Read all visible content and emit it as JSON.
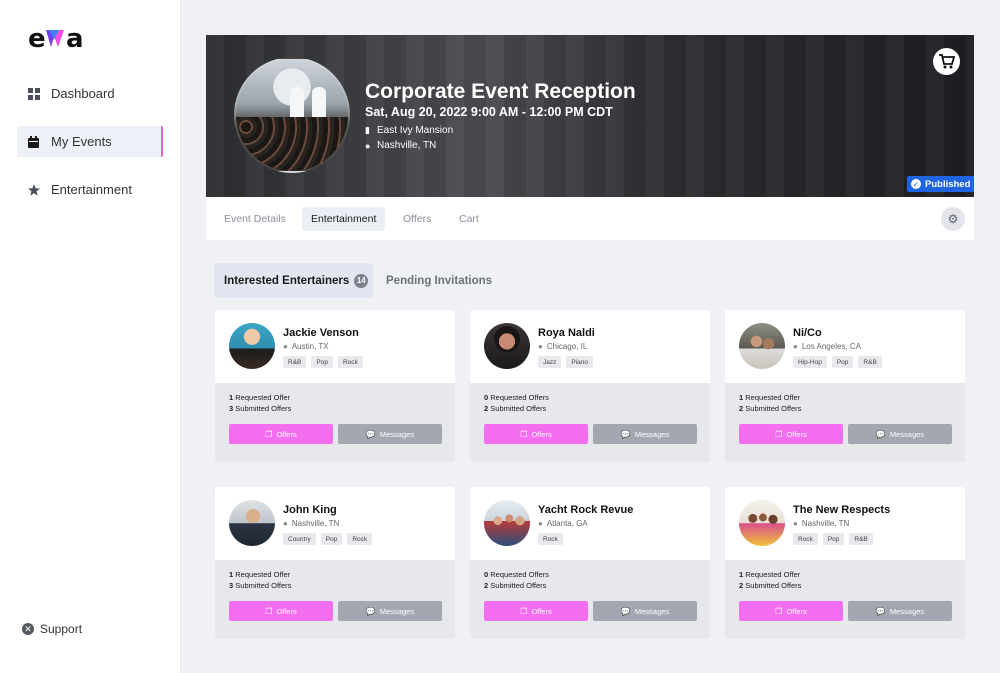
{
  "app": {
    "logo": "eva"
  },
  "sidebar": {
    "items": [
      {
        "label": "Dashboard",
        "icon": "grid-icon"
      },
      {
        "label": "My Events",
        "icon": "calendar-icon"
      },
      {
        "label": "Entertainment",
        "icon": "star-icon"
      }
    ],
    "support": "Support"
  },
  "event": {
    "title": "Corporate Event Reception",
    "datetime": "Sat, Aug 20, 2022 9:00 AM - 12:00 PM CDT",
    "venue": "East Ivy Mansion",
    "city": "Nashville, TN",
    "status": "Published"
  },
  "tabs": [
    "Event Details",
    "Entertainment",
    "Offers",
    "Cart"
  ],
  "subtabs": {
    "interested": "Interested Entertainers",
    "count": "14",
    "pending": "Pending Invitations"
  },
  "labels": {
    "requested": "Requested Offer",
    "requested_plural": "Requested Offers",
    "submitted": "Submitted Offers",
    "offers_btn": "Offers",
    "messages_btn": "Messages"
  },
  "cards": [
    {
      "name": "Jackie Venson",
      "location": "Austin, TX",
      "genres": [
        "R&B",
        "Pop",
        "Rock"
      ],
      "requested": "1",
      "requested_label": "Requested Offer",
      "submitted": "3"
    },
    {
      "name": "Roya Naldi",
      "location": "Chicago, IL",
      "genres": [
        "Jazz",
        "Piano"
      ],
      "requested": "0",
      "requested_label": "Requested Offers",
      "submitted": "2"
    },
    {
      "name": "Ni/Co",
      "location": "Los Angeles, CA",
      "genres": [
        "Hip-Hop",
        "Pop",
        "R&B"
      ],
      "requested": "1",
      "requested_label": "Requested Offer",
      "submitted": "2"
    },
    {
      "name": "John King",
      "location": "Nashville, TN",
      "genres": [
        "Country",
        "Pop",
        "Rock"
      ],
      "requested": "1",
      "requested_label": "Requested Offer",
      "submitted": "3"
    },
    {
      "name": "Yacht Rock Revue",
      "location": "Atlanta, GA",
      "genres": [
        "Rock"
      ],
      "requested": "0",
      "requested_label": "Requested Offers",
      "submitted": "2"
    },
    {
      "name": "The New Respects",
      "location": "Nashville, TN",
      "genres": [
        "Rock",
        "Pop",
        "R&B"
      ],
      "requested": "1",
      "requested_label": "Requested Offer",
      "submitted": "2"
    }
  ],
  "colors": {
    "accent": "#f46ef0",
    "published": "#1f64e0",
    "active_bar": "#e25fd6"
  }
}
